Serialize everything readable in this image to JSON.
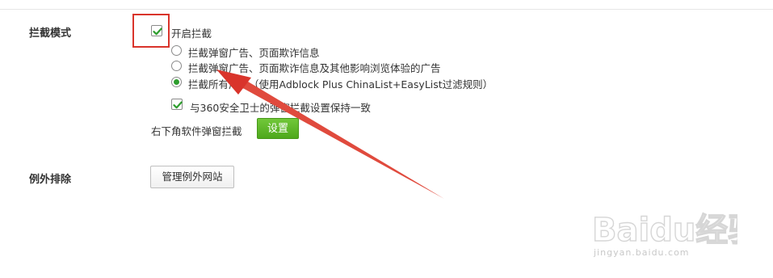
{
  "sections": {
    "block_mode_label": "拦截模式",
    "exceptions_label": "例外排除"
  },
  "block_mode": {
    "enable_label": "开启拦截",
    "enable_checked": true,
    "options": [
      {
        "label": "拦截弹窗广告、页面欺诈信息",
        "selected": false
      },
      {
        "label": "拦截弹窗广告、页面欺诈信息及其他影响浏览体验的广告",
        "selected": false
      },
      {
        "label": "拦截所有广告（使用Adblock Plus ChinaList+EasyList过滤规则）",
        "selected": true
      }
    ],
    "sync_360_label": "与360安全卫士的弹窗拦截设置保持一致",
    "sync_360_checked": true,
    "lower_right_label": "右下角软件弹窗拦截",
    "settings_button": "设置"
  },
  "exceptions": {
    "manage_button": "管理例外网站"
  },
  "watermark": {
    "brand": "Baidu经验",
    "url": "jingyan.baidu.com"
  },
  "colors": {
    "accent_green": "#4ea81c",
    "radio_selected": "#2e9e2e",
    "annotation_red": "#d9342b"
  },
  "icons": {
    "checkbox_check": "check-icon",
    "annotation_arrow": "arrow-annotation"
  }
}
